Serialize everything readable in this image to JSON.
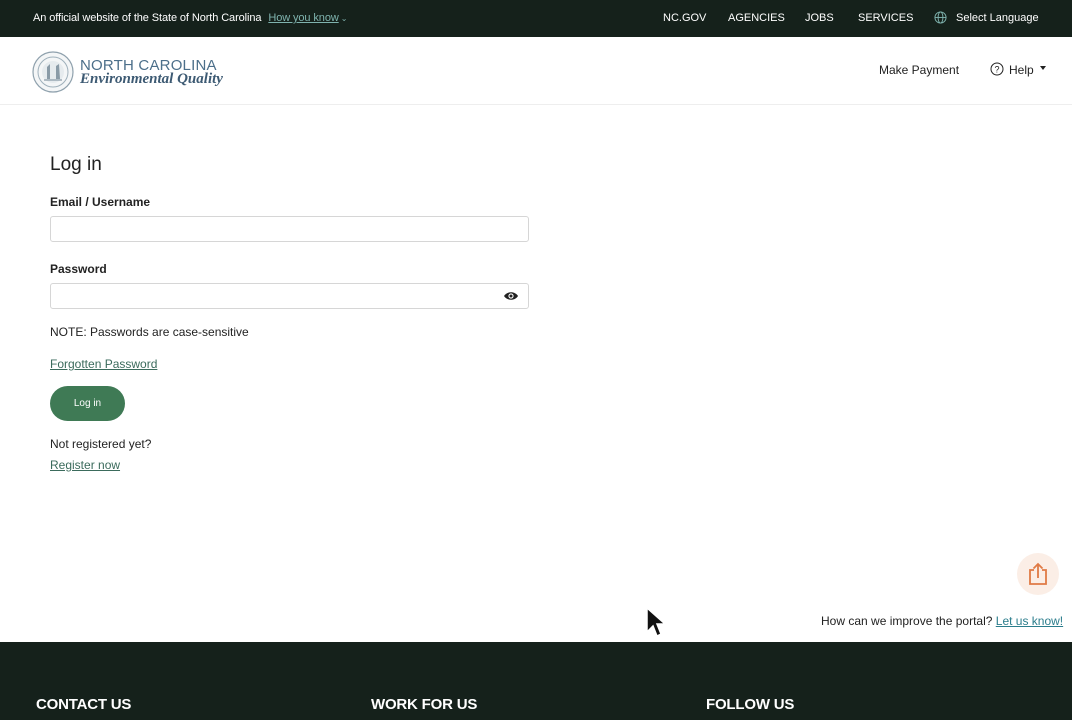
{
  "govbar": {
    "official_text": "An official website of the State of North Carolina",
    "how_you_know": "How you know",
    "links": [
      "NC.GOV",
      "AGENCIES",
      "JOBS",
      "SERVICES"
    ],
    "select_language": "Select Language"
  },
  "header": {
    "logo_line1": "NORTH CAROLINA",
    "logo_line2": "Environmental Quality",
    "make_payment": "Make Payment",
    "help": "Help"
  },
  "login": {
    "title": "Log in",
    "email_label": "Email / Username",
    "email_value": "",
    "password_label": "Password",
    "password_value": "",
    "note": "NOTE: Passwords are case-sensitive",
    "forgotten_password": "Forgotten Password",
    "login_button": "Log in",
    "not_registered": "Not registered yet?",
    "register_now": "Register now"
  },
  "feedback": {
    "prompt": "How can we improve the portal?",
    "link": "Let us know!"
  },
  "footer": {
    "contact_us": "CONTACT US",
    "work_for_us": "WORK FOR US",
    "follow_us": "FOLLOW US"
  },
  "colors": {
    "dark_green": "#15211b",
    "button_green": "#3f7a55",
    "link_green": "#3b6b5c",
    "feedback_link": "#2b7d8c",
    "share_accent": "#e07a45"
  },
  "icons": [
    "chevron-down-icon",
    "globe-icon",
    "seal-logo",
    "help-circle-icon",
    "caret-down-icon",
    "eye-icon",
    "share-upload-icon",
    "mouse-pointer-icon"
  ]
}
